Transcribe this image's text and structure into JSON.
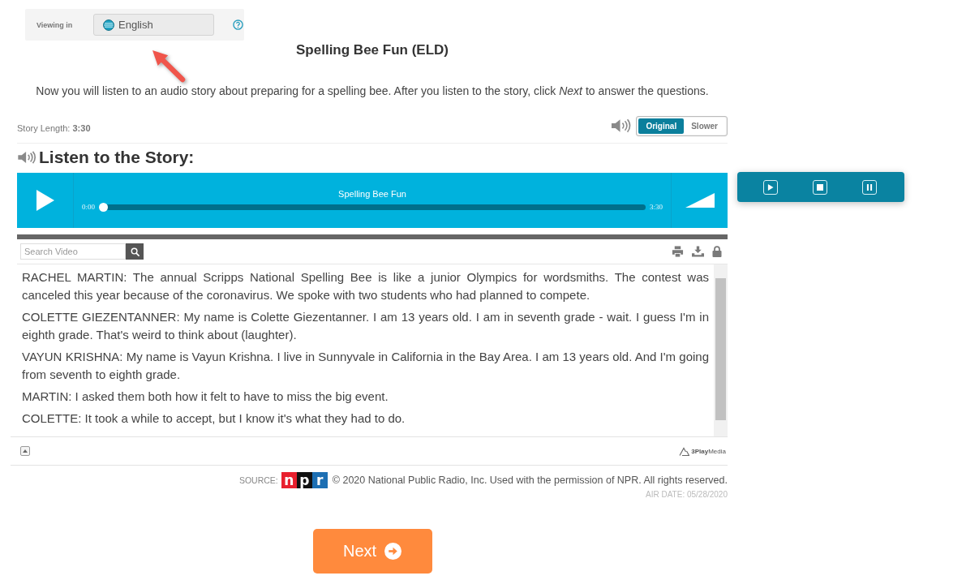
{
  "language_bar": {
    "label": "Viewing in",
    "language": "English"
  },
  "title": "Spelling Bee Fun (ELD)",
  "instructions": "Now you will listen to an audio story about preparing for a spelling bee. After you listen to the story, click *Next* to answer the questions.",
  "story_length": "Story Length: **3:30**",
  "speed_options": [
    {
      "label": "Original",
      "selected": true
    },
    {
      "label": "Slower",
      "selected": false
    }
  ],
  "section_heading": "Listen to the Story:",
  "audio_player": {
    "title": "Spelling Bee Fun",
    "elapsed": "0:00",
    "duration": "3:30",
    "level": 0
  },
  "transcript": {
    "search_placeholder": "Search Video",
    "paragraphs": [
      "RACHEL MARTIN: The annual Scripps National Spelling Bee is like a junior Olympics for wordsmiths. The contest was canceled this year because of the coronavirus. We spoke with two students who had planned to compete.",
      "COLETTE GIEZENTANNER: My name is Colette Giezentanner. I am 13 years old. I am in seventh grade - wait. I guess I'm in eighth grade. That's weird to think about (laughter).",
      "VAYUN KRISHNA: My name is Vayun Krishna. I live in Sunnyvale in California in the Bay Area. I am 13 years old. And I'm going from seventh to eighth grade.",
      "MARTIN: I asked them both how it felt to have to miss the big event.",
      "COLETTE: It took a while to accept, but I know it's what they had to do."
    ]
  },
  "powered_by": "**3Play**Media",
  "source": {
    "label": "SOURCE:",
    "logo_letters": [
      {
        "letter": "n",
        "color": "#e8202e"
      },
      {
        "letter": "p",
        "color": "#111111"
      },
      {
        "letter": "r",
        "color": "#1d6fb3"
      }
    ],
    "notice": "© 2020 National Public Radio, Inc. Used with the permission of NPR. All rights reserved.",
    "air_date": "AIR DATE: 05/28/2020"
  },
  "next_button": "Next"
}
